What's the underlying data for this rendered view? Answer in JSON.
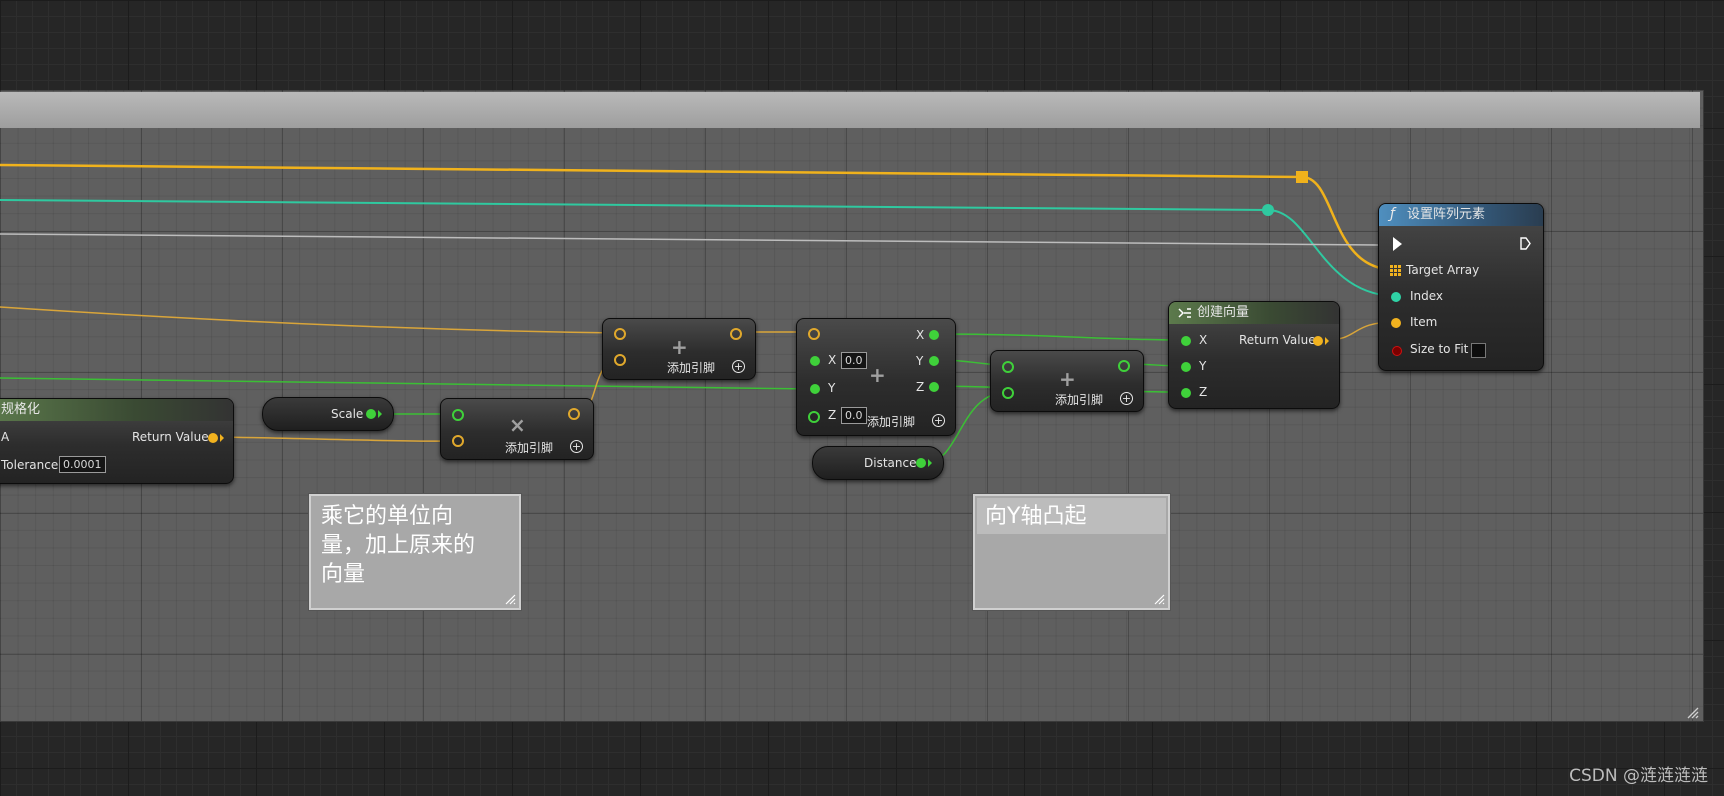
{
  "nodes": {
    "normalize": {
      "title": "规格化",
      "pin_a": "A",
      "return_value": "Return Value",
      "tolerance_label": "Tolerance",
      "tolerance_value": "0.0001"
    },
    "scale": {
      "label": "Scale"
    },
    "multiply": {
      "symbol": "×",
      "add_pin": "添加引脚"
    },
    "add1": {
      "symbol": "+",
      "add_pin": "添加引脚"
    },
    "add_vector": {
      "symbol": "+",
      "add_pin": "添加引脚",
      "x_label": "X",
      "x_value": "0.0",
      "y_label": "Y",
      "z_label": "Z",
      "z_value": "0.0",
      "out_x": "X",
      "out_y": "Y",
      "out_z": "Z"
    },
    "distance": {
      "label": "Distance"
    },
    "add2": {
      "symbol": "+",
      "add_pin": "添加引脚"
    },
    "make_vector": {
      "title": "创建向量",
      "x": "X",
      "y": "Y",
      "z": "Z",
      "return_value": "Return Value"
    },
    "set_array_elem": {
      "title": "设置阵列元素",
      "target_array": "Target Array",
      "index": "Index",
      "item": "Item",
      "size_to_fit": "Size to Fit"
    }
  },
  "comments": {
    "note1": "乘它的单位向量，加上原来的向量",
    "note1_lines": [
      "乘它的单位向",
      "量，加上原来的",
      "向量"
    ],
    "note2": "向Y轴凸起"
  },
  "colors": {
    "float_pin": "#f1b21f",
    "vector_pin": "#3fd13a",
    "int_pin": "#2fd3a6",
    "bool_pin": "#d01010",
    "blueprint_bg": "#262626",
    "comment_bg": "#5f5f5f"
  },
  "watermark": "CSDN @涟涟涟涟"
}
